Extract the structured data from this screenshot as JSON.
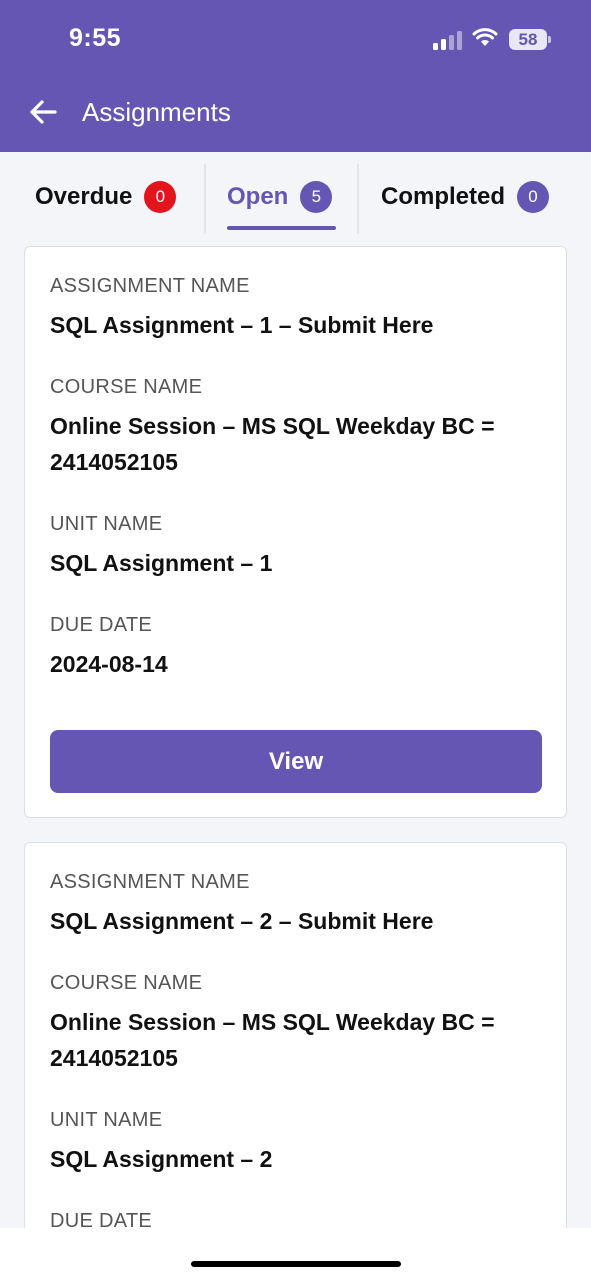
{
  "status_bar": {
    "time": "9:55",
    "battery": "58"
  },
  "header": {
    "title": "Assignments",
    "back_icon": "arrow-left-icon"
  },
  "colors": {
    "primary": "#6656b4",
    "badge_red": "#e3141b"
  },
  "tabs": [
    {
      "label": "Overdue",
      "count": "0",
      "active": false
    },
    {
      "label": "Open",
      "count": "5",
      "active": true
    },
    {
      "label": "Completed",
      "count": "0",
      "active": false
    }
  ],
  "cards": [
    {
      "assignment_label": "ASSIGNMENT NAME",
      "assignment_name": "SQL Assignment – 1 – Submit Here",
      "course_label": "COURSE NAME",
      "course_name": "Online Session – MS SQL Weekday BC = 2414052105",
      "unit_label": "UNIT NAME",
      "unit_name": "SQL Assignment – 1",
      "due_label": "DUE DATE",
      "due_date": "2024-08-14",
      "button_label": "View"
    },
    {
      "assignment_label": "ASSIGNMENT NAME",
      "assignment_name": "SQL Assignment – 2 – Submit Here",
      "course_label": "COURSE NAME",
      "course_name": "Online Session – MS SQL Weekday BC = 2414052105",
      "unit_label": "UNIT NAME",
      "unit_name": "SQL Assignment – 2",
      "due_label": "DUE DATE"
    }
  ]
}
